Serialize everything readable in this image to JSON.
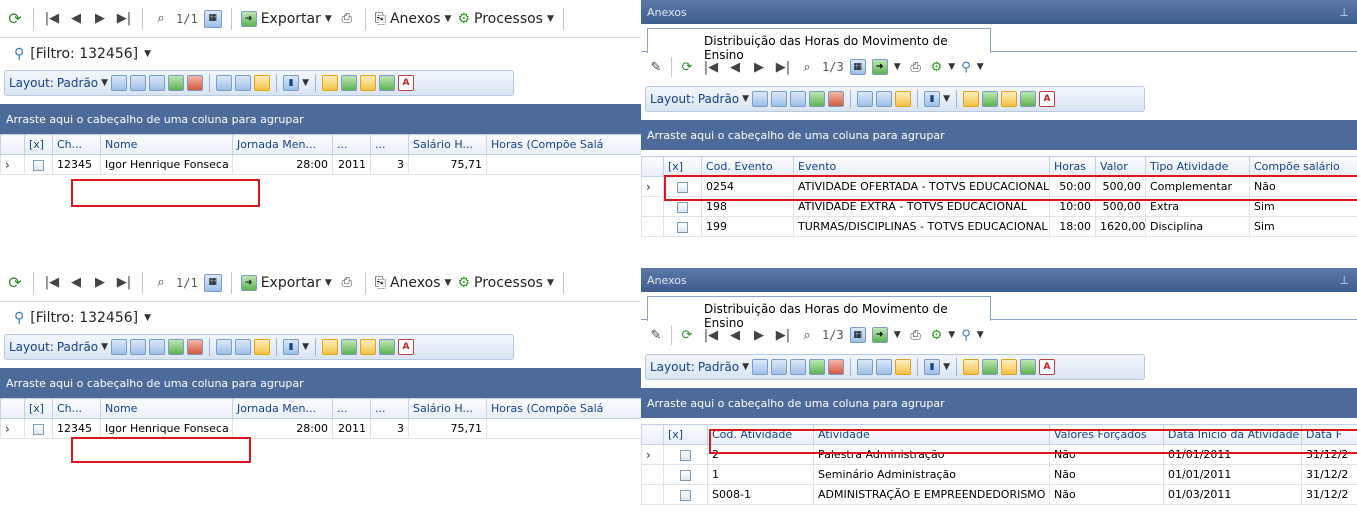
{
  "left_panel": {
    "nav_count": "1/1",
    "export_label": "Exportar",
    "attachments_label": "Anexos",
    "processes_label": "Processos",
    "filter_label": "[Filtro: 132456]",
    "layout_label": "Layout:",
    "layout_value": "Padrão",
    "group_hint": "Arraste aqui o cabeçalho de uma coluna para agrupar",
    "columns": [
      "[x]",
      "Ch...",
      "Nome",
      "Jornada Men...",
      "...",
      "...",
      "Salário H...",
      "Horas (Compõe Salá"
    ],
    "top_row": {
      "chapa": "12345",
      "nome": "Igor Henrique Fonseca",
      "jornada": "28:00",
      "ano": "2011",
      "mes": "3",
      "salario": "75,71"
    },
    "bottom_row": {
      "chapa": "12345",
      "nome": "Igor Henrique Fonseca",
      "jornada": "28:00",
      "ano": "2011",
      "mes": "3",
      "salario": "75,71"
    }
  },
  "right_top": {
    "panel_title": "Anexos",
    "tab_label": "Distribuição das Horas do Movimento de Ensino",
    "nav_count": "1/3",
    "layout_label": "Layout:",
    "layout_value": "Padrão",
    "group_hint": "Arraste aqui o cabeçalho de uma coluna para agrupar",
    "columns": [
      "[x]",
      "Cod. Evento",
      "Evento",
      "Horas",
      "Valor",
      "Tipo Atividade",
      "Compõe salário"
    ],
    "rows": [
      {
        "cod": "0254",
        "evento": "ATIVIDADE OFERTADA - TOTVS EDUCACIONAL",
        "horas": "50:00",
        "valor": "500,00",
        "tipo": "Complementar",
        "compoe": "Não"
      },
      {
        "cod": "198",
        "evento": "ATIVIDADE EXTRA - TOTVS EDUCACIONAL",
        "horas": "10:00",
        "valor": "500,00",
        "tipo": "Extra",
        "compoe": "Sim"
      },
      {
        "cod": "199",
        "evento": "TURMAS/DISCIPLINAS - TOTVS EDUCACIONAL",
        "horas": "18:00",
        "valor": "1620,00",
        "tipo": "Disciplina",
        "compoe": "Sim"
      }
    ]
  },
  "right_bottom": {
    "panel_title": "Anexos",
    "tab_label": "Distribuição das Horas do Movimento de Ensino",
    "nav_count": "1/3",
    "layout_label": "Layout:",
    "layout_value": "Padrão",
    "group_hint": "Arraste aqui o cabeçalho de uma coluna para agrupar",
    "columns": [
      "[x]",
      "Cod. Atividade",
      "Atividade",
      "Valores Forçados",
      "Data Início da Atividade",
      "Data F"
    ],
    "rows": [
      {
        "cod": "2",
        "atividade": "Palestra Administração",
        "forcados": "Não",
        "inicio": "01/01/2011",
        "fim": "31/12/2"
      },
      {
        "cod": "1",
        "atividade": "Seminário Administração",
        "forcados": "Não",
        "inicio": "01/01/2011",
        "fim": "31/12/2"
      },
      {
        "cod": "S008-1",
        "atividade": "ADMINISTRAÇÃO E EMPREENDEDORISMO I",
        "forcados": "Não",
        "inicio": "01/03/2011",
        "fim": "31/12/2"
      }
    ]
  },
  "icons": {
    "refresh": "refresh-icon",
    "first": "first-record-icon",
    "prev": "prev-record-icon",
    "next": "next-record-icon",
    "last": "last-record-icon",
    "find": "binoculars-icon",
    "grid": "grid-icon",
    "export": "export-arrow-icon",
    "print": "printer-icon",
    "attach": "paperclip-icon",
    "process": "gears-icon",
    "filter": "filter-icon",
    "pin": "pin-icon"
  },
  "colors": {
    "group_header": "#4d6b9a",
    "title_bar": "#4a6898",
    "header_text": "#15428b",
    "highlight": "#e0141e"
  }
}
